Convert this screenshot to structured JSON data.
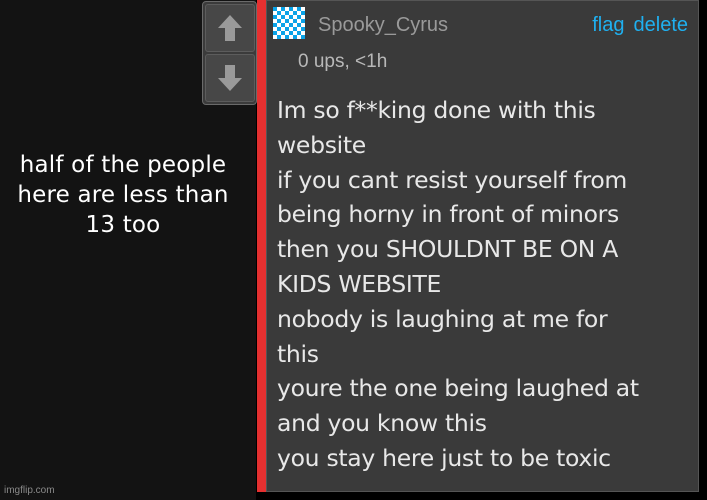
{
  "caption": "half of the people here are less than 13 too",
  "watermark": "imgflip.com",
  "vote": {
    "up_icon": "arrow-up-icon",
    "down_icon": "arrow-down-icon"
  },
  "comment": {
    "username": "Spooky_Cyrus",
    "avatar_icon": "checker-avatar-icon",
    "meta": "0 ups, <1h",
    "flag_label": "flag",
    "delete_label": "delete",
    "lines": [
      "Im so f**king done with this",
      "website",
      "if you cant resist yourself from",
      "being horny in front of minors",
      "then you SHOULDNT BE ON A",
      "KIDS WEBSITE",
      "nobody is laughing at me for",
      "this",
      "youre the one being laughed at",
      "and you know this",
      "you stay here just to be toxic"
    ]
  },
  "colors": {
    "accent_link": "#1fb0f0",
    "strip": "#e53030",
    "panel": "#3a3a3a"
  }
}
